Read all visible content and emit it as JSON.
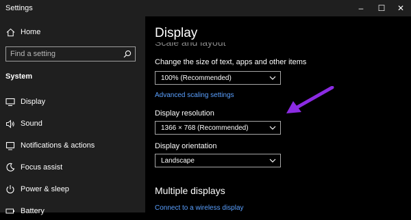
{
  "window": {
    "title": "Settings",
    "controls": [
      "–",
      "☐",
      "✕"
    ]
  },
  "sidebar": {
    "home_label": "Home",
    "search_placeholder": "Find a setting",
    "section_label": "System",
    "items": [
      {
        "label": "Display",
        "icon": "monitor-icon"
      },
      {
        "label": "Sound",
        "icon": "speaker-icon"
      },
      {
        "label": "Notifications & actions",
        "icon": "notification-icon"
      },
      {
        "label": "Focus assist",
        "icon": "moon-icon"
      },
      {
        "label": "Power & sleep",
        "icon": "power-icon"
      },
      {
        "label": "Battery",
        "icon": "battery-icon"
      }
    ]
  },
  "main": {
    "page_title": "Display",
    "partial_heading": "Scale and layout",
    "scale_label": "Change the size of text, apps and other items",
    "scale_value": "100% (Recommended)",
    "advanced_link": "Advanced scaling settings",
    "resolution_label": "Display resolution",
    "resolution_value": "1366 × 768 (Recommended)",
    "orientation_label": "Display orientation",
    "orientation_value": "Landscape",
    "multiple_heading": "Multiple displays",
    "wireless_link": "Connect to a wireless display"
  },
  "annotation": {
    "arrow_color": "#8b2be2"
  }
}
